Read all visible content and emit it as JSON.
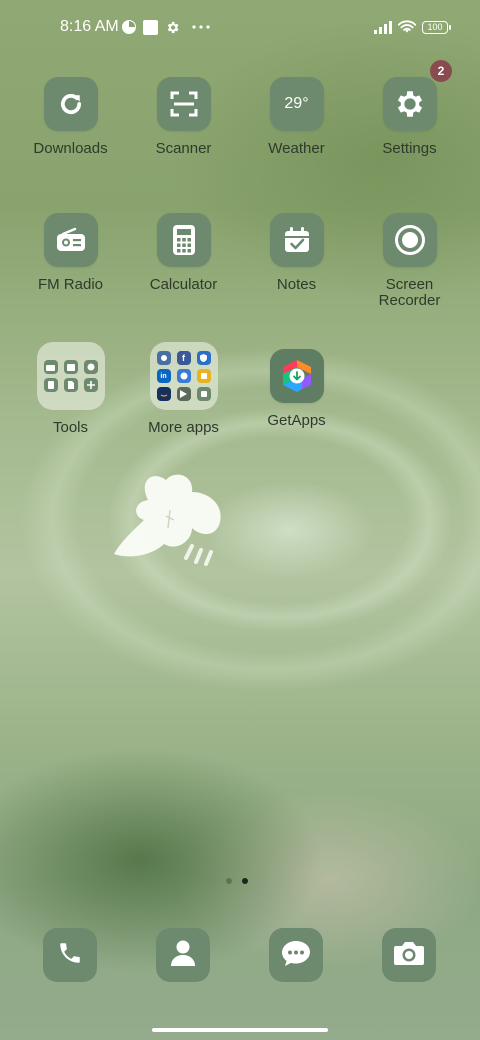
{
  "status_bar": {
    "time": "8:16 AM",
    "battery": "100",
    "icons": [
      "data-saver-icon",
      "square-notification-icon",
      "gear-icon",
      "more-dots-icon",
      "signal-icon",
      "wifi-icon",
      "battery-icon"
    ]
  },
  "apps": [
    {
      "label": "Downloads",
      "icon": "refresh-download-icon"
    },
    {
      "label": "Scanner",
      "icon": "scan-frame-icon"
    },
    {
      "label": "Weather",
      "icon": "weather-temperature",
      "value": "29°"
    },
    {
      "label": "Settings",
      "icon": "gear-icon",
      "badge": "2"
    },
    {
      "label": "FM Radio",
      "icon": "radio-icon"
    },
    {
      "label": "Calculator",
      "icon": "calculator-icon"
    },
    {
      "label": "Notes",
      "icon": "calendar-check-icon"
    },
    {
      "label": "Screen Recorder",
      "icon": "record-icon"
    },
    {
      "label": "Tools",
      "icon": "folder-icon"
    },
    {
      "label": "More apps",
      "icon": "folder-icon"
    },
    {
      "label": "GetApps",
      "icon": "getapps-icon"
    }
  ],
  "dock": [
    {
      "icon": "phone-icon"
    },
    {
      "icon": "contacts-icon"
    },
    {
      "icon": "messages-icon"
    },
    {
      "icon": "camera-icon"
    }
  ],
  "colors": {
    "tile": "#6e8a6e",
    "badge": "#8a4b50",
    "label": "#2f3a2c"
  },
  "pages": {
    "count": 2,
    "active": 2
  }
}
